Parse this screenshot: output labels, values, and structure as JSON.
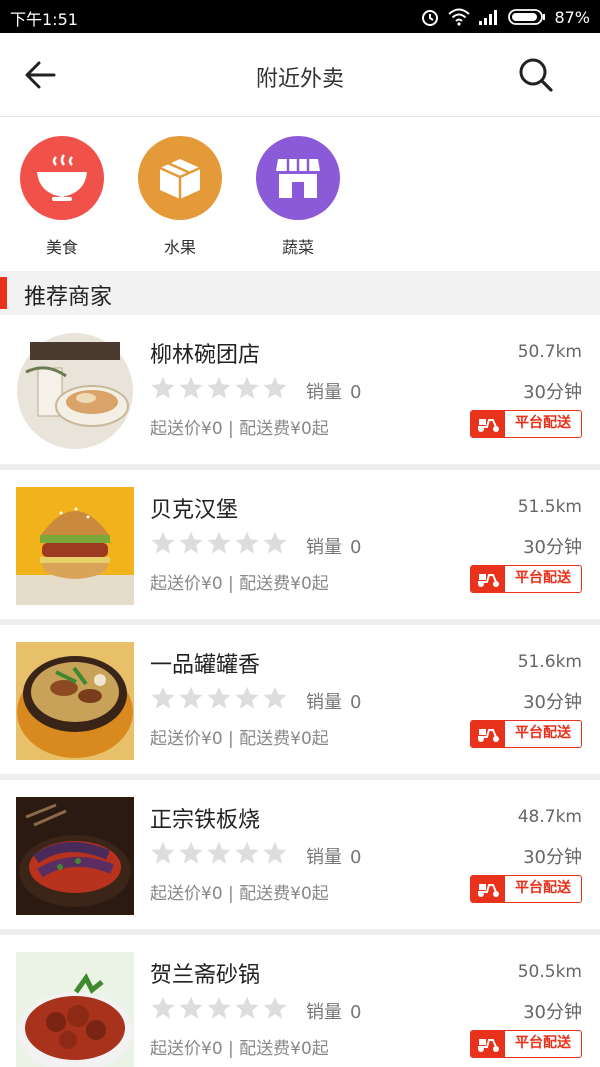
{
  "status_bar": {
    "time": "下午1:51",
    "battery": "87%"
  },
  "header": {
    "title": "附近外卖"
  },
  "categories": [
    {
      "label": "美食",
      "color": "#f0524a",
      "icon": "bowl-icon"
    },
    {
      "label": "水果",
      "color": "#e59a3a",
      "icon": "box-icon"
    },
    {
      "label": "蔬菜",
      "color": "#8a5ad8",
      "icon": "store-icon"
    }
  ],
  "section": {
    "title": "推荐商家"
  },
  "shops": [
    {
      "name": "柳林碗团店",
      "distance": "50.7km",
      "sales_label": "销量",
      "sales": "0",
      "time": "30分钟",
      "fee": "起送价¥0 | 配送费¥0起",
      "badge": "平台配送",
      "rating": 0
    },
    {
      "name": "贝克汉堡",
      "distance": "51.5km",
      "sales_label": "销量",
      "sales": "0",
      "time": "30分钟",
      "fee": "起送价¥0 | 配送费¥0起",
      "badge": "平台配送",
      "rating": 0
    },
    {
      "name": "一品罐罐香",
      "distance": "51.6km",
      "sales_label": "销量",
      "sales": "0",
      "time": "30分钟",
      "fee": "起送价¥0 | 配送费¥0起",
      "badge": "平台配送",
      "rating": 0
    },
    {
      "name": "正宗铁板烧",
      "distance": "48.7km",
      "sales_label": "销量",
      "sales": "0",
      "time": "30分钟",
      "fee": "起送价¥0 | 配送费¥0起",
      "badge": "平台配送",
      "rating": 0
    },
    {
      "name": "贺兰斋砂锅",
      "distance": "50.5km",
      "sales_label": "销量",
      "sales": "0",
      "time": "30分钟",
      "fee": "起送价¥0 | 配送费¥0起",
      "badge": "平台配送",
      "rating": 0
    }
  ],
  "colors": {
    "accent": "#e8321b",
    "star_empty": "#dddddd"
  }
}
